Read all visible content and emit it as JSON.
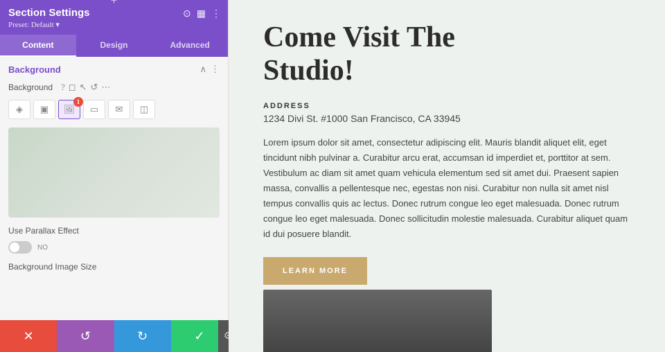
{
  "panel": {
    "title": "Section Settings",
    "preset": "Preset: Default ▾",
    "tabs": [
      "Content",
      "Design",
      "Advanced"
    ],
    "active_tab": "Content",
    "background_section": "Background",
    "bg_label": "Background",
    "bg_type_buttons": [
      {
        "id": "gradient",
        "icon": "◈",
        "active": false
      },
      {
        "id": "color",
        "icon": "▣",
        "active": false
      },
      {
        "id": "image",
        "icon": "🖼",
        "active": true,
        "badge": "1"
      },
      {
        "id": "video",
        "icon": "▭",
        "active": false
      },
      {
        "id": "pattern",
        "icon": "✉",
        "active": false
      },
      {
        "id": "map",
        "icon": "◫",
        "active": false
      }
    ],
    "parallax_label": "Use Parallax Effect",
    "parallax_value": "NO",
    "bg_size_label": "Background Image Size"
  },
  "toolbar": {
    "cancel_icon": "✕",
    "undo_icon": "↺",
    "redo_icon": "↻",
    "save_icon": "✓",
    "gear_icon": "⚙"
  },
  "content": {
    "heading": "Come Visit The\nStudio!",
    "address_label": "ADDRESS",
    "address_value": "1234 Divi St. #1000 San Francisco, CA 33945",
    "body_text": "Lorem ipsum dolor sit amet, consectetur adipiscing elit. Mauris blandit aliquet elit, eget tincidunt nibh pulvinar a. Curabitur arcu erat, accumsan id imperdiet et, porttitor at sem. Vestibulum ac diam sit amet quam vehicula elementum sed sit amet dui. Praesent sapien massa, convallis a pellentesque nec, egestas non nisi. Curabitur non nulla sit amet nisl tempus convallis quis ac lectus. Donec rutrum congue leo eget malesuada. Donec rutrum congue leo eget malesuada. Donec sollicitudin molestie malesuada. Curabitur aliquet quam id dui posuere blandit.",
    "learn_more": "LEARN MORE"
  }
}
